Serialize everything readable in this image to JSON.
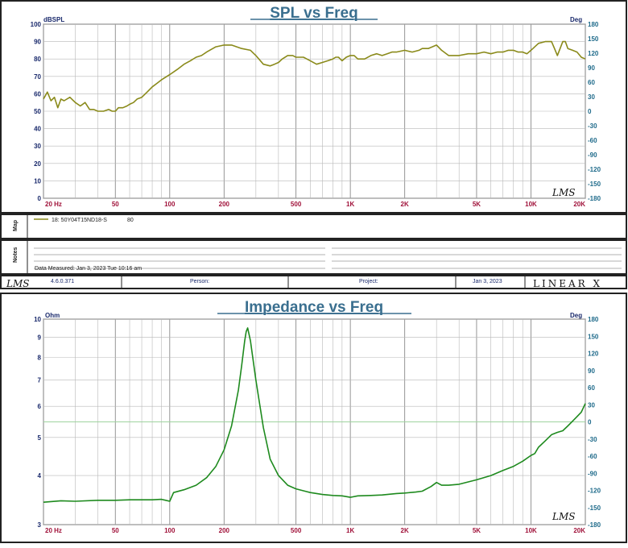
{
  "colors": {
    "spl_line": "#8a8a1a",
    "imp_line": "#1e8a1e",
    "ref_line": "#9fd39f",
    "border": "#222222"
  },
  "chart_data": [
    {
      "type": "line",
      "title": "SPL vs Freq",
      "ylabel_left": "dBSPL",
      "ylabel_right": "Deg",
      "x_scale": "log",
      "xlim": [
        20,
        20000
      ],
      "ylim": [
        0,
        100
      ],
      "y2lim": [
        -180,
        180
      ],
      "x_ticks": [
        "20 Hz",
        "50",
        "100",
        "200",
        "500",
        "1K",
        "2K",
        "5K",
        "10K",
        "20K"
      ],
      "y_ticks": [
        "100",
        "90",
        "80",
        "70",
        "60",
        "50",
        "40",
        "30",
        "20",
        "10",
        "0"
      ],
      "y2_ticks": [
        "180",
        "150",
        "120",
        "90",
        "60",
        "30",
        "0",
        "-30",
        "-60",
        "-90",
        "-120",
        "-150",
        "-180"
      ],
      "grid": true,
      "watermark": "LMS",
      "series": [
        {
          "name": "18: 50Y04T15ND18-S",
          "x": [
            20,
            21,
            22,
            23,
            24,
            25,
            26,
            28,
            30,
            32,
            34,
            36,
            38,
            40,
            43,
            46,
            48,
            50,
            52,
            55,
            58,
            60,
            63,
            66,
            70,
            75,
            80,
            85,
            90,
            100,
            110,
            120,
            130,
            140,
            150,
            160,
            180,
            200,
            220,
            250,
            280,
            300,
            330,
            360,
            380,
            400,
            420,
            450,
            480,
            500,
            550,
            600,
            650,
            700,
            750,
            800,
            830,
            860,
            900,
            950,
            1000,
            1050,
            1100,
            1200,
            1300,
            1400,
            1500,
            1600,
            1700,
            1800,
            2000,
            2200,
            2400,
            2500,
            2700,
            3000,
            3200,
            3500,
            4000,
            4500,
            5000,
            5500,
            6000,
            6500,
            7000,
            7500,
            8000,
            8500,
            9000,
            9500,
            10000,
            11000,
            12000,
            13000,
            13500,
            14000,
            15000,
            15500,
            16000,
            17000,
            18000,
            19000,
            20000
          ],
          "values": [
            57,
            61,
            56,
            58,
            52,
            57,
            56,
            58,
            55,
            53,
            55,
            51,
            51,
            50,
            50,
            51,
            50,
            50,
            52,
            52,
            53,
            54,
            55,
            57,
            58,
            61,
            64,
            66,
            68,
            71,
            74,
            77,
            79,
            81,
            82,
            84,
            87,
            88,
            88,
            86,
            85,
            82,
            77,
            76,
            77,
            78,
            80,
            82,
            82,
            81,
            81,
            79,
            77,
            78,
            79,
            80,
            81,
            81,
            79,
            81,
            82,
            82,
            80,
            80,
            82,
            83,
            82,
            83,
            84,
            84,
            85,
            84,
            85,
            86,
            86,
            88,
            85,
            82,
            82,
            83,
            83,
            84,
            83,
            84,
            84,
            85,
            85,
            84,
            84,
            83,
            85,
            89,
            90,
            90,
            86,
            82,
            90,
            90,
            86,
            85,
            84,
            81,
            80
          ]
        }
      ]
    },
    {
      "type": "line",
      "title": "Impedance vs Freq",
      "ylabel_left": "Ohm",
      "ylabel_right": "Deg",
      "x_scale": "log",
      "y_scale": "log",
      "xlim": [
        20,
        20000
      ],
      "ylim": [
        3,
        10
      ],
      "y2lim": [
        -180,
        180
      ],
      "x_ticks": [
        "20 Hz",
        "50",
        "100",
        "200",
        "500",
        "1K",
        "2K",
        "5K",
        "10K",
        "20K"
      ],
      "y_ticks": [
        "10",
        "9",
        "8",
        "7",
        "6",
        "5",
        "4",
        "3"
      ],
      "y2_ticks": [
        "180",
        "150",
        "120",
        "90",
        "60",
        "30",
        "0",
        "-30",
        "-60",
        "-90",
        "-120",
        "-150",
        "-180"
      ],
      "reference_line_deg": 0,
      "grid": true,
      "watermark": "LMS",
      "series": [
        {
          "x": [
            20,
            25,
            30,
            40,
            50,
            60,
            70,
            80,
            90,
            95,
            100,
            105,
            120,
            140,
            160,
            180,
            200,
            220,
            240,
            250,
            260,
            265,
            270,
            280,
            300,
            330,
            360,
            400,
            450,
            500,
            600,
            700,
            800,
            900,
            1000,
            1100,
            1300,
            1500,
            1800,
            2000,
            2300,
            2500,
            2800,
            3000,
            3200,
            3500,
            4000,
            5000,
            6000,
            7000,
            8000,
            9000,
            10000,
            10500,
            11000,
            12000,
            13000,
            14000,
            15000,
            16000,
            17000,
            18000,
            19000,
            20000
          ],
          "values": [
            3.42,
            3.45,
            3.44,
            3.46,
            3.46,
            3.47,
            3.47,
            3.47,
            3.48,
            3.46,
            3.44,
            3.62,
            3.68,
            3.78,
            3.95,
            4.22,
            4.65,
            5.35,
            6.6,
            7.6,
            8.8,
            9.3,
            9.5,
            8.8,
            7.0,
            5.3,
            4.4,
            4.0,
            3.78,
            3.7,
            3.62,
            3.58,
            3.56,
            3.55,
            3.52,
            3.55,
            3.56,
            3.57,
            3.6,
            3.61,
            3.63,
            3.65,
            3.75,
            3.84,
            3.78,
            3.78,
            3.8,
            3.9,
            4.0,
            4.12,
            4.22,
            4.35,
            4.5,
            4.55,
            4.72,
            4.9,
            5.08,
            5.15,
            5.2,
            5.35,
            5.5,
            5.65,
            5.8,
            6.1
          ]
        }
      ]
    }
  ],
  "legend": {
    "side_label": "Map",
    "entry_text": "18: 50Y04T15ND18-S",
    "entry_value": "80"
  },
  "notes": {
    "side_label": "Notes",
    "measured": "Data Measured: Jan  3, 2023   Tue 10:16 am"
  },
  "footer": {
    "logo": "LMS",
    "version": "4.6.0.371",
    "person_label": "Person:",
    "project_label": "Project:",
    "date": "Jan  3, 2023",
    "brand": "LINEAR X"
  }
}
